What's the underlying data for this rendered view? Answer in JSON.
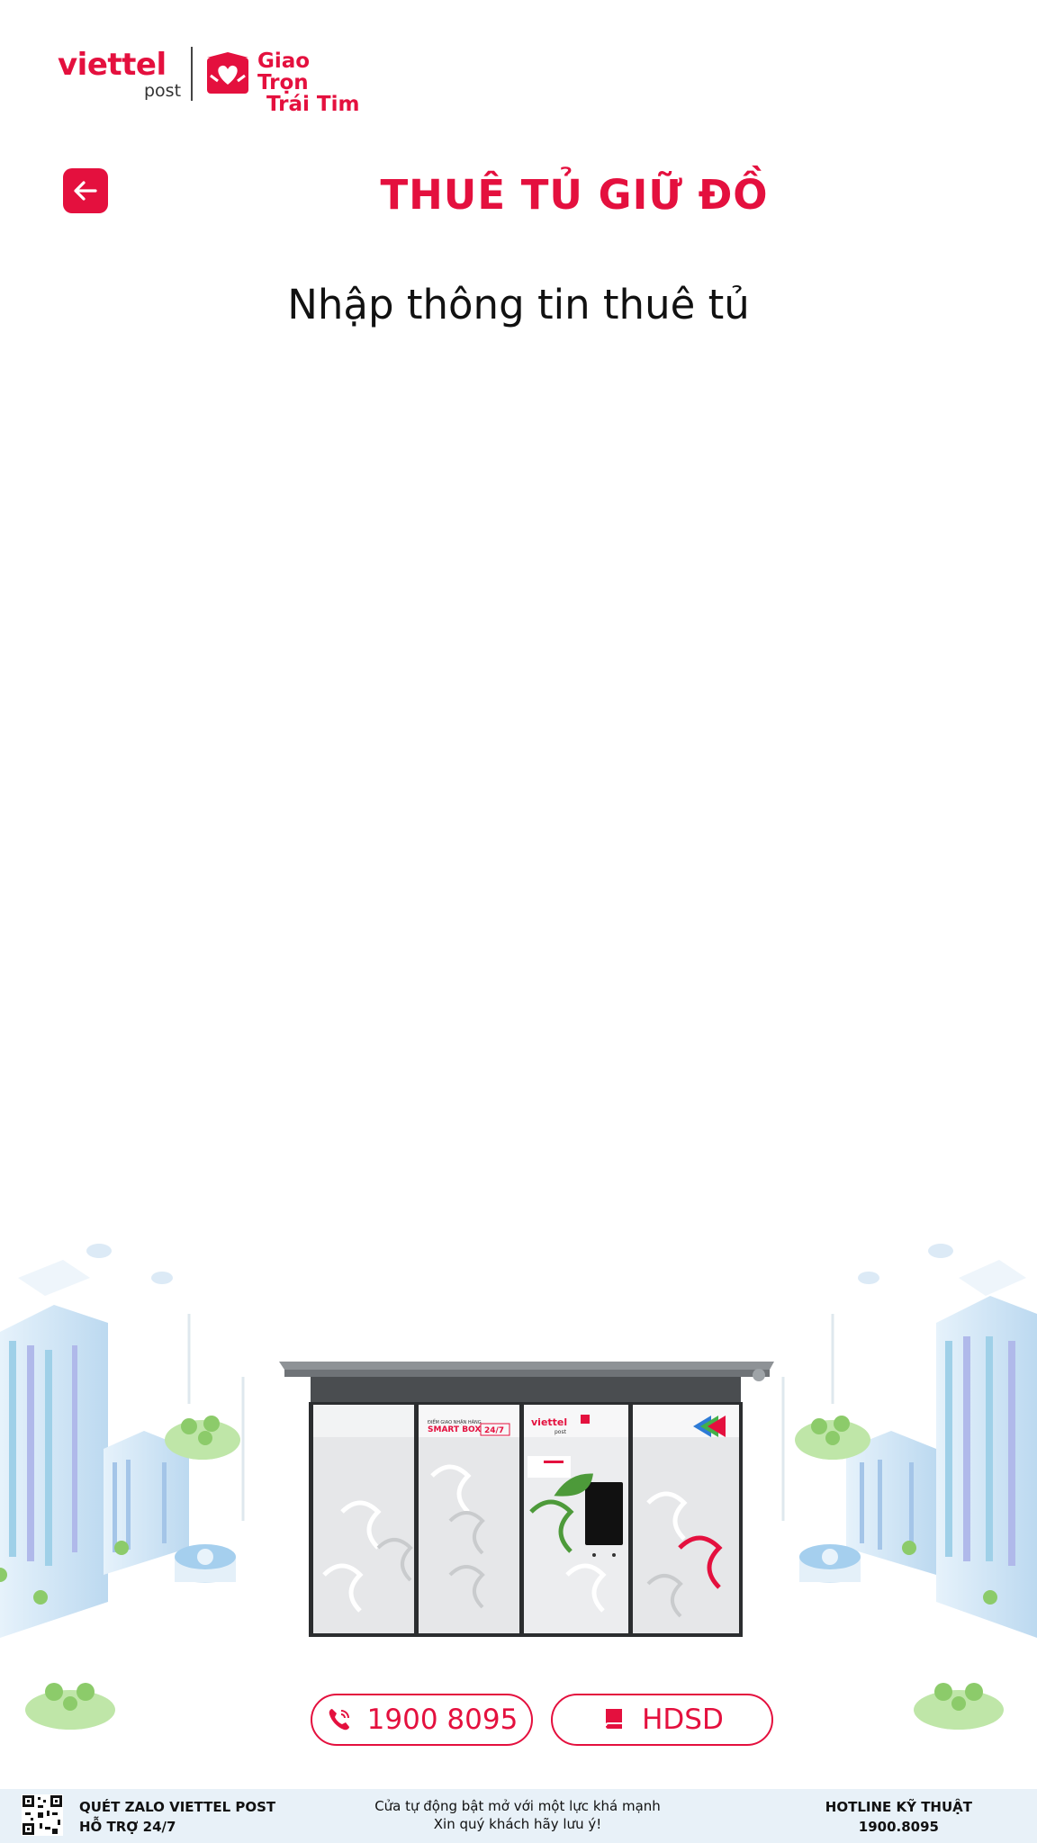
{
  "brand": {
    "name": "viettel",
    "sub": "post",
    "tagline_line1": "Giao Trọn",
    "tagline_line2": "Trái Tim",
    "color": "#e4103e"
  },
  "header": {
    "title": "THUÊ TỦ GIỮ ĐỒ",
    "subtitle": "Nhập thông tin thuê tủ",
    "back_icon": "arrow-left-icon"
  },
  "locker": {
    "panel_label_small": "ĐIỂM GIAO NHẬN HÀNG",
    "panel_label": "SMART BOX",
    "panel_badge": "24/7",
    "brand_name": "viettel",
    "brand_sub": "post",
    "brand_tagline": "Giao Trọn Trái Tim"
  },
  "actions": {
    "hotline_label": "1900 8095",
    "hotline_icon": "phone-icon",
    "guide_label": "HDSD",
    "guide_icon": "book-icon"
  },
  "footer": {
    "zalo_line1": "QUÉT ZALO VIETTEL POST",
    "zalo_line2": "HỖ TRỢ 24/7",
    "notice_line1": "Cửa tự động bật mở với một lực khá mạnh",
    "notice_line2": "Xin quý khách hãy lưu ý!",
    "hotline_title": "HOTLINE KỸ THUẬT",
    "hotline_number": "1900.8095"
  }
}
